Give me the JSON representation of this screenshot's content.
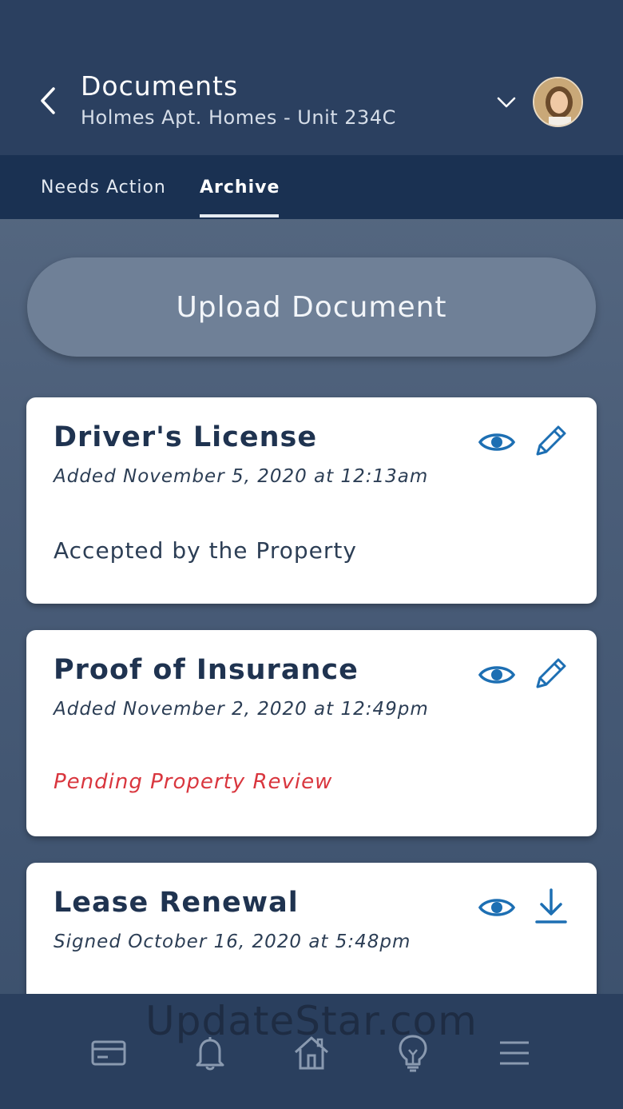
{
  "header": {
    "title": "Documents",
    "subtitle": "Holmes Apt. Homes - Unit 234C",
    "back_icon": "chevron-left-icon",
    "dropdown_icon": "chevron-down-icon",
    "avatar": "user-avatar"
  },
  "tabs": [
    {
      "label": "Needs Action",
      "active": false
    },
    {
      "label": "Archive",
      "active": true
    }
  ],
  "upload": {
    "label": "Upload Document"
  },
  "documents": [
    {
      "title": "Driver's License",
      "date": "Added November 5, 2020 at 12:13am",
      "status": "Accepted by the Property",
      "status_type": "accepted",
      "actions": [
        "eye-icon",
        "pencil-icon"
      ]
    },
    {
      "title": "Proof of Insurance",
      "date": "Added November 2, 2020 at 12:49pm",
      "status": "Pending Property Review",
      "status_type": "pending",
      "actions": [
        "eye-icon",
        "pencil-icon"
      ]
    },
    {
      "title": "Lease Renewal",
      "date": "Signed October 16, 2020 at 5:48pm",
      "status": "",
      "actions": [
        "eye-icon",
        "download-icon"
      ]
    }
  ],
  "bottom_nav": [
    {
      "icon": "credit-card-icon"
    },
    {
      "icon": "bell-icon"
    },
    {
      "icon": "home-icon"
    },
    {
      "icon": "lightbulb-icon"
    },
    {
      "icon": "menu-icon"
    }
  ],
  "watermark": "UpdateStar.com",
  "colors": {
    "header_bg": "#2b4060",
    "tabs_bg": "#1a3152",
    "accent_blue": "#1d6fb3",
    "pending_red": "#d9363e",
    "card_text": "#1f3350"
  }
}
